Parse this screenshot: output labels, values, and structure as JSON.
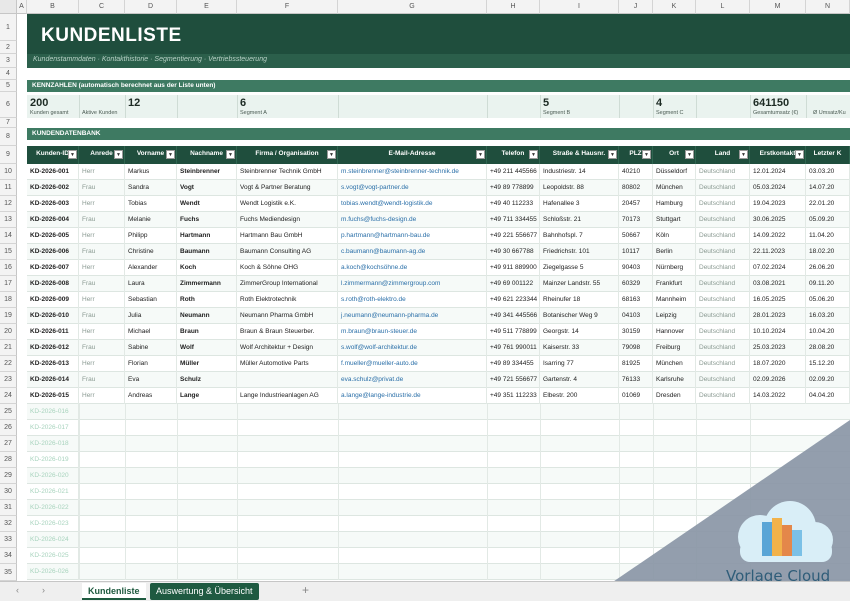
{
  "columns": [
    "A",
    "B",
    "C",
    "D",
    "E",
    "F",
    "G",
    "H",
    "I",
    "J",
    "K",
    "L",
    "M",
    "N"
  ],
  "title": "KUNDENLISTE",
  "subtitle": "Kundenstammdaten · Kontakthistorie · Segmentierung · Vertriebssteuerung",
  "kpi_section": "KENNZAHLEN (automatisch berechnet aus der Liste unten)",
  "kpis": [
    {
      "value": "200",
      "label": "Kunden gesamt"
    },
    {
      "value": "",
      "label": "Aktive Kunden"
    },
    {
      "value": "12",
      "label": ""
    },
    {
      "value": "6",
      "label": "Segment A"
    },
    {
      "value": "5",
      "label": "Segment B"
    },
    {
      "value": "4",
      "label": "Segment C"
    },
    {
      "value": "641150",
      "label": "Gesamtumsatz (€)"
    },
    {
      "value": "",
      "label": "Ø Umsatz/Ku"
    }
  ],
  "db_section": "KUNDENDATENBANK",
  "headers": [
    "Kunden-ID",
    "Anrede",
    "Vorname",
    "Nachname",
    "Firma / Organisation",
    "E-Mail-Adresse",
    "Telefon",
    "Straße & Hausnr.",
    "PLZ",
    "Ort",
    "Land",
    "Erstkontakt",
    "Letzter K"
  ],
  "rows": [
    [
      "KD-2026-001",
      "Herr",
      "Markus",
      "Steinbrenner",
      "Steinbrenner Technik GmbH",
      "m.steinbrenner@steinbrenner-technik.de",
      "+49 211 445566",
      "Industriestr. 14",
      "40210",
      "Düsseldorf",
      "Deutschland",
      "12.01.2024",
      "03.03.20"
    ],
    [
      "KD-2026-002",
      "Frau",
      "Sandra",
      "Vogt",
      "Vogt & Partner Beratung",
      "s.vogt@vogt-partner.de",
      "+49 89 778899",
      "Leopoldstr. 88",
      "80802",
      "München",
      "Deutschland",
      "05.03.2024",
      "14.07.20"
    ],
    [
      "KD-2026-003",
      "Herr",
      "Tobias",
      "Wendt",
      "Wendt Logistik e.K.",
      "tobias.wendt@wendt-logistik.de",
      "+49 40 112233",
      "Hafenallee 3",
      "20457",
      "Hamburg",
      "Deutschland",
      "19.04.2023",
      "22.01.20"
    ],
    [
      "KD-2026-004",
      "Frau",
      "Melanie",
      "Fuchs",
      "Fuchs Mediendesign",
      "m.fuchs@fuchs-design.de",
      "+49 711 334455",
      "Schloßstr. 21",
      "70173",
      "Stuttgart",
      "Deutschland",
      "30.06.2025",
      "05.09.20"
    ],
    [
      "KD-2026-005",
      "Herr",
      "Philipp",
      "Hartmann",
      "Hartmann Bau GmbH",
      "p.hartmann@hartmann-bau.de",
      "+49 221 556677",
      "Bahnhofspl. 7",
      "50667",
      "Köln",
      "Deutschland",
      "14.09.2022",
      "11.04.20"
    ],
    [
      "KD-2026-006",
      "Frau",
      "Christine",
      "Baumann",
      "Baumann Consulting AG",
      "c.baumann@baumann-ag.de",
      "+49 30 667788",
      "Friedrichstr. 101",
      "10117",
      "Berlin",
      "Deutschland",
      "22.11.2023",
      "18.02.20"
    ],
    [
      "KD-2026-007",
      "Herr",
      "Alexander",
      "Koch",
      "Koch & Söhne OHG",
      "a.koch@kochsöhne.de",
      "+49 911 889900",
      "Ziegelgasse 5",
      "90403",
      "Nürnberg",
      "Deutschland",
      "07.02.2024",
      "26.06.20"
    ],
    [
      "KD-2026-008",
      "Frau",
      "Laura",
      "Zimmermann",
      "ZimmerGroup International",
      "l.zimmermann@zimmergroup.com",
      "+49 69 001122",
      "Mainzer Landstr. 55",
      "60329",
      "Frankfurt",
      "Deutschland",
      "03.08.2021",
      "09.11.20"
    ],
    [
      "KD-2026-009",
      "Herr",
      "Sebastian",
      "Roth",
      "Roth Elektrotechnik",
      "s.roth@roth-elektro.de",
      "+49 621 223344",
      "Rheinufer 18",
      "68163",
      "Mannheim",
      "Deutschland",
      "16.05.2025",
      "05.06.20"
    ],
    [
      "KD-2026-010",
      "Frau",
      "Julia",
      "Neumann",
      "Neumann Pharma GmbH",
      "j.neumann@neumann-pharma.de",
      "+49 341 445566",
      "Botanischer Weg 9",
      "04103",
      "Leipzig",
      "Deutschland",
      "28.01.2023",
      "16.03.20"
    ],
    [
      "KD-2026-011",
      "Herr",
      "Michael",
      "Braun",
      "Braun & Braun Steuerber.",
      "m.braun@braun-steuer.de",
      "+49 511 778899",
      "Georgstr. 14",
      "30159",
      "Hannover",
      "Deutschland",
      "10.10.2024",
      "10.04.20"
    ],
    [
      "KD-2026-012",
      "Frau",
      "Sabine",
      "Wolf",
      "Wolf Architektur + Design",
      "s.wolf@wolf-architektur.de",
      "+49 761 990011",
      "Kaiserstr. 33",
      "79098",
      "Freiburg",
      "Deutschland",
      "25.03.2023",
      "28.08.20"
    ],
    [
      "KD-2026-013",
      "Herr",
      "Florian",
      "Müller",
      "Müller Automotive Parts",
      "f.mueller@mueller-auto.de",
      "+49 89 334455",
      "Isarring 77",
      "81925",
      "München",
      "Deutschland",
      "18.07.2020",
      "15.12.20"
    ],
    [
      "KD-2026-014",
      "Frau",
      "Eva",
      "Schulz",
      "",
      "eva.schulz@privat.de",
      "+49 721 556677",
      "Gartenstr. 4",
      "76133",
      "Karlsruhe",
      "Deutschland",
      "02.09.2026",
      "02.09.20"
    ],
    [
      "KD-2026-015",
      "Herr",
      "Andreas",
      "Lange",
      "Lange Industrieanlagen AG",
      "a.lange@lange-industrie.de",
      "+49 351 112233",
      "Elbestr. 200",
      "01069",
      "Dresden",
      "Deutschland",
      "14.03.2022",
      "04.04.20"
    ]
  ],
  "empty_ids": [
    "KD-2026-016",
    "KD-2026-017",
    "KD-2026-018",
    "KD-2026-019",
    "KD-2026-020",
    "KD-2026-021",
    "KD-2026-022",
    "KD-2026-023",
    "KD-2026-024",
    "KD-2026-025",
    "KD-2026-026"
  ],
  "row_numbers": [
    "1",
    "2",
    "3",
    "4",
    "5",
    "6",
    "7",
    "8",
    "9",
    "10",
    "11",
    "12",
    "13",
    "14",
    "15",
    "16",
    "17",
    "18",
    "19",
    "20",
    "21",
    "22",
    "23",
    "24",
    "25",
    "26",
    "27",
    "28",
    "29",
    "30",
    "31",
    "32",
    "33",
    "34",
    "35"
  ],
  "tabs": {
    "active": "Kundenliste",
    "other": "Auswertung & Übersicht",
    "add": "+"
  },
  "watermark": {
    "brand": "Vorlage Cloud"
  },
  "colors": {
    "dark_green": "#1f4e3d",
    "section_green": "#3e7a62",
    "link": "#2a6fa8"
  }
}
